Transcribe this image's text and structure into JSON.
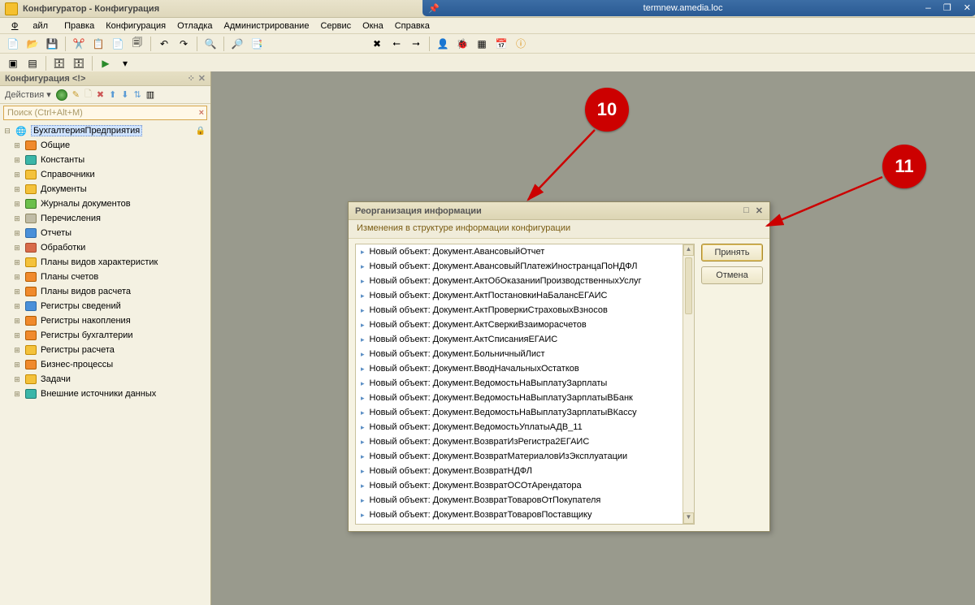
{
  "remote": {
    "title": "termnew.amedia.loc"
  },
  "window": {
    "title": "Конфигуратор - Конфигурация"
  },
  "menu": {
    "file": "Файл",
    "edit": "Правка",
    "config": "Конфигурация",
    "debug": "Отладка",
    "admin": "Администрирование",
    "service": "Сервис",
    "windows": "Окна",
    "help": "Справка"
  },
  "sidebar": {
    "title": "Конфигурация <!>",
    "actions": "Действия",
    "search_placeholder": "Поиск (Ctrl+Alt+M)",
    "root": "БухгалтерияПредприятия",
    "items": [
      "Общие",
      "Константы",
      "Справочники",
      "Документы",
      "Журналы документов",
      "Перечисления",
      "Отчеты",
      "Обработки",
      "Планы видов характеристик",
      "Планы счетов",
      "Планы видов расчета",
      "Регистры сведений",
      "Регистры накопления",
      "Регистры бухгалтерии",
      "Регистры расчета",
      "Бизнес-процессы",
      "Задачи",
      "Внешние источники данных"
    ]
  },
  "dialog": {
    "title": "Реорганизация информации",
    "subtitle": "Изменения в структуре информации конфигурации",
    "accept": "Принять",
    "cancel": "Отмена",
    "prefix": "Новый объект:",
    "items": [
      "Документ.АвансовыйОтчет",
      "Документ.АвансовыйПлатежИностранцаПоНДФЛ",
      "Документ.АктОбОказанииПроизводственныхУслуг",
      "Документ.АктПостановкиНаБалансЕГАИС",
      "Документ.АктПроверкиСтраховыхВзносов",
      "Документ.АктСверкиВзаиморасчетов",
      "Документ.АктСписанияЕГАИС",
      "Документ.БольничныйЛист",
      "Документ.ВводНачальныхОстатков",
      "Документ.ВедомостьНаВыплатуЗарплаты",
      "Документ.ВедомостьНаВыплатуЗарплатыВБанк",
      "Документ.ВедомостьНаВыплатуЗарплатыВКассу",
      "Документ.ВедомостьУплатыАДВ_11",
      "Документ.ВозвратИзРегистра2ЕГАИС",
      "Документ.ВозвратМатериаловИзЭксплуатации",
      "Документ.ВозвратНДФЛ",
      "Документ.ВозвратОСОтАрендатора",
      "Документ.ВозвратТоваровОтПокупателя",
      "Документ.ВозвратТоваровПоставщику"
    ]
  },
  "annotations": {
    "b10": "10",
    "b11": "11"
  }
}
